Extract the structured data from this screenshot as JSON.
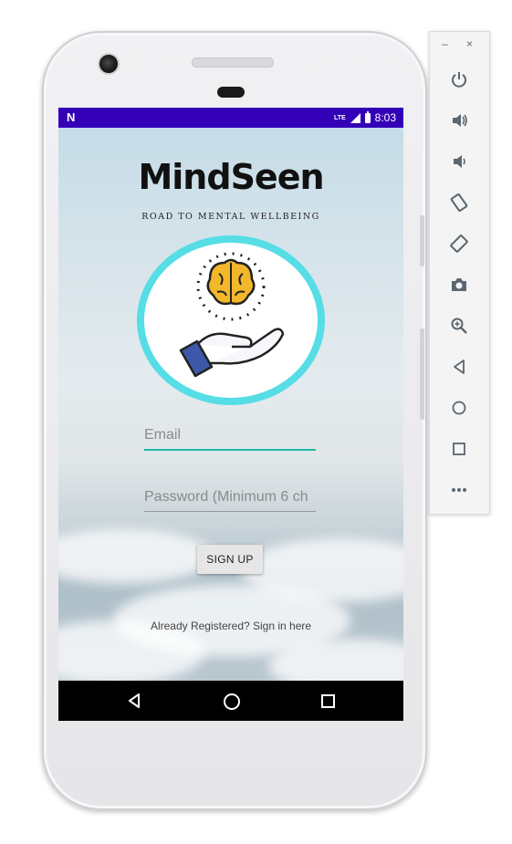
{
  "status_bar": {
    "notification": "N",
    "network": "LTE",
    "time": "8:03"
  },
  "app": {
    "title": "MindSeen",
    "tagline": "ROAD TO MENTAL WELLBEING"
  },
  "form": {
    "email_placeholder": "Email",
    "password_placeholder": "Password (Minimum 6 ch",
    "signup_label": "SIGN UP",
    "signin_link": "Already Registered? Sign in here"
  },
  "colors": {
    "status_bar": "#3300b8",
    "emblem_ring": "#56dde6",
    "input_focus": "#1fb9a9"
  },
  "emulator_toolbar": {
    "window_controls": [
      "minimize-icon",
      "close-icon"
    ],
    "buttons": [
      "power-icon",
      "volume-up-icon",
      "volume-down-icon",
      "rotate-left-icon",
      "rotate-right-icon",
      "camera-icon",
      "zoom-icon",
      "back-icon",
      "home-icon",
      "overview-icon",
      "more-icon"
    ]
  }
}
